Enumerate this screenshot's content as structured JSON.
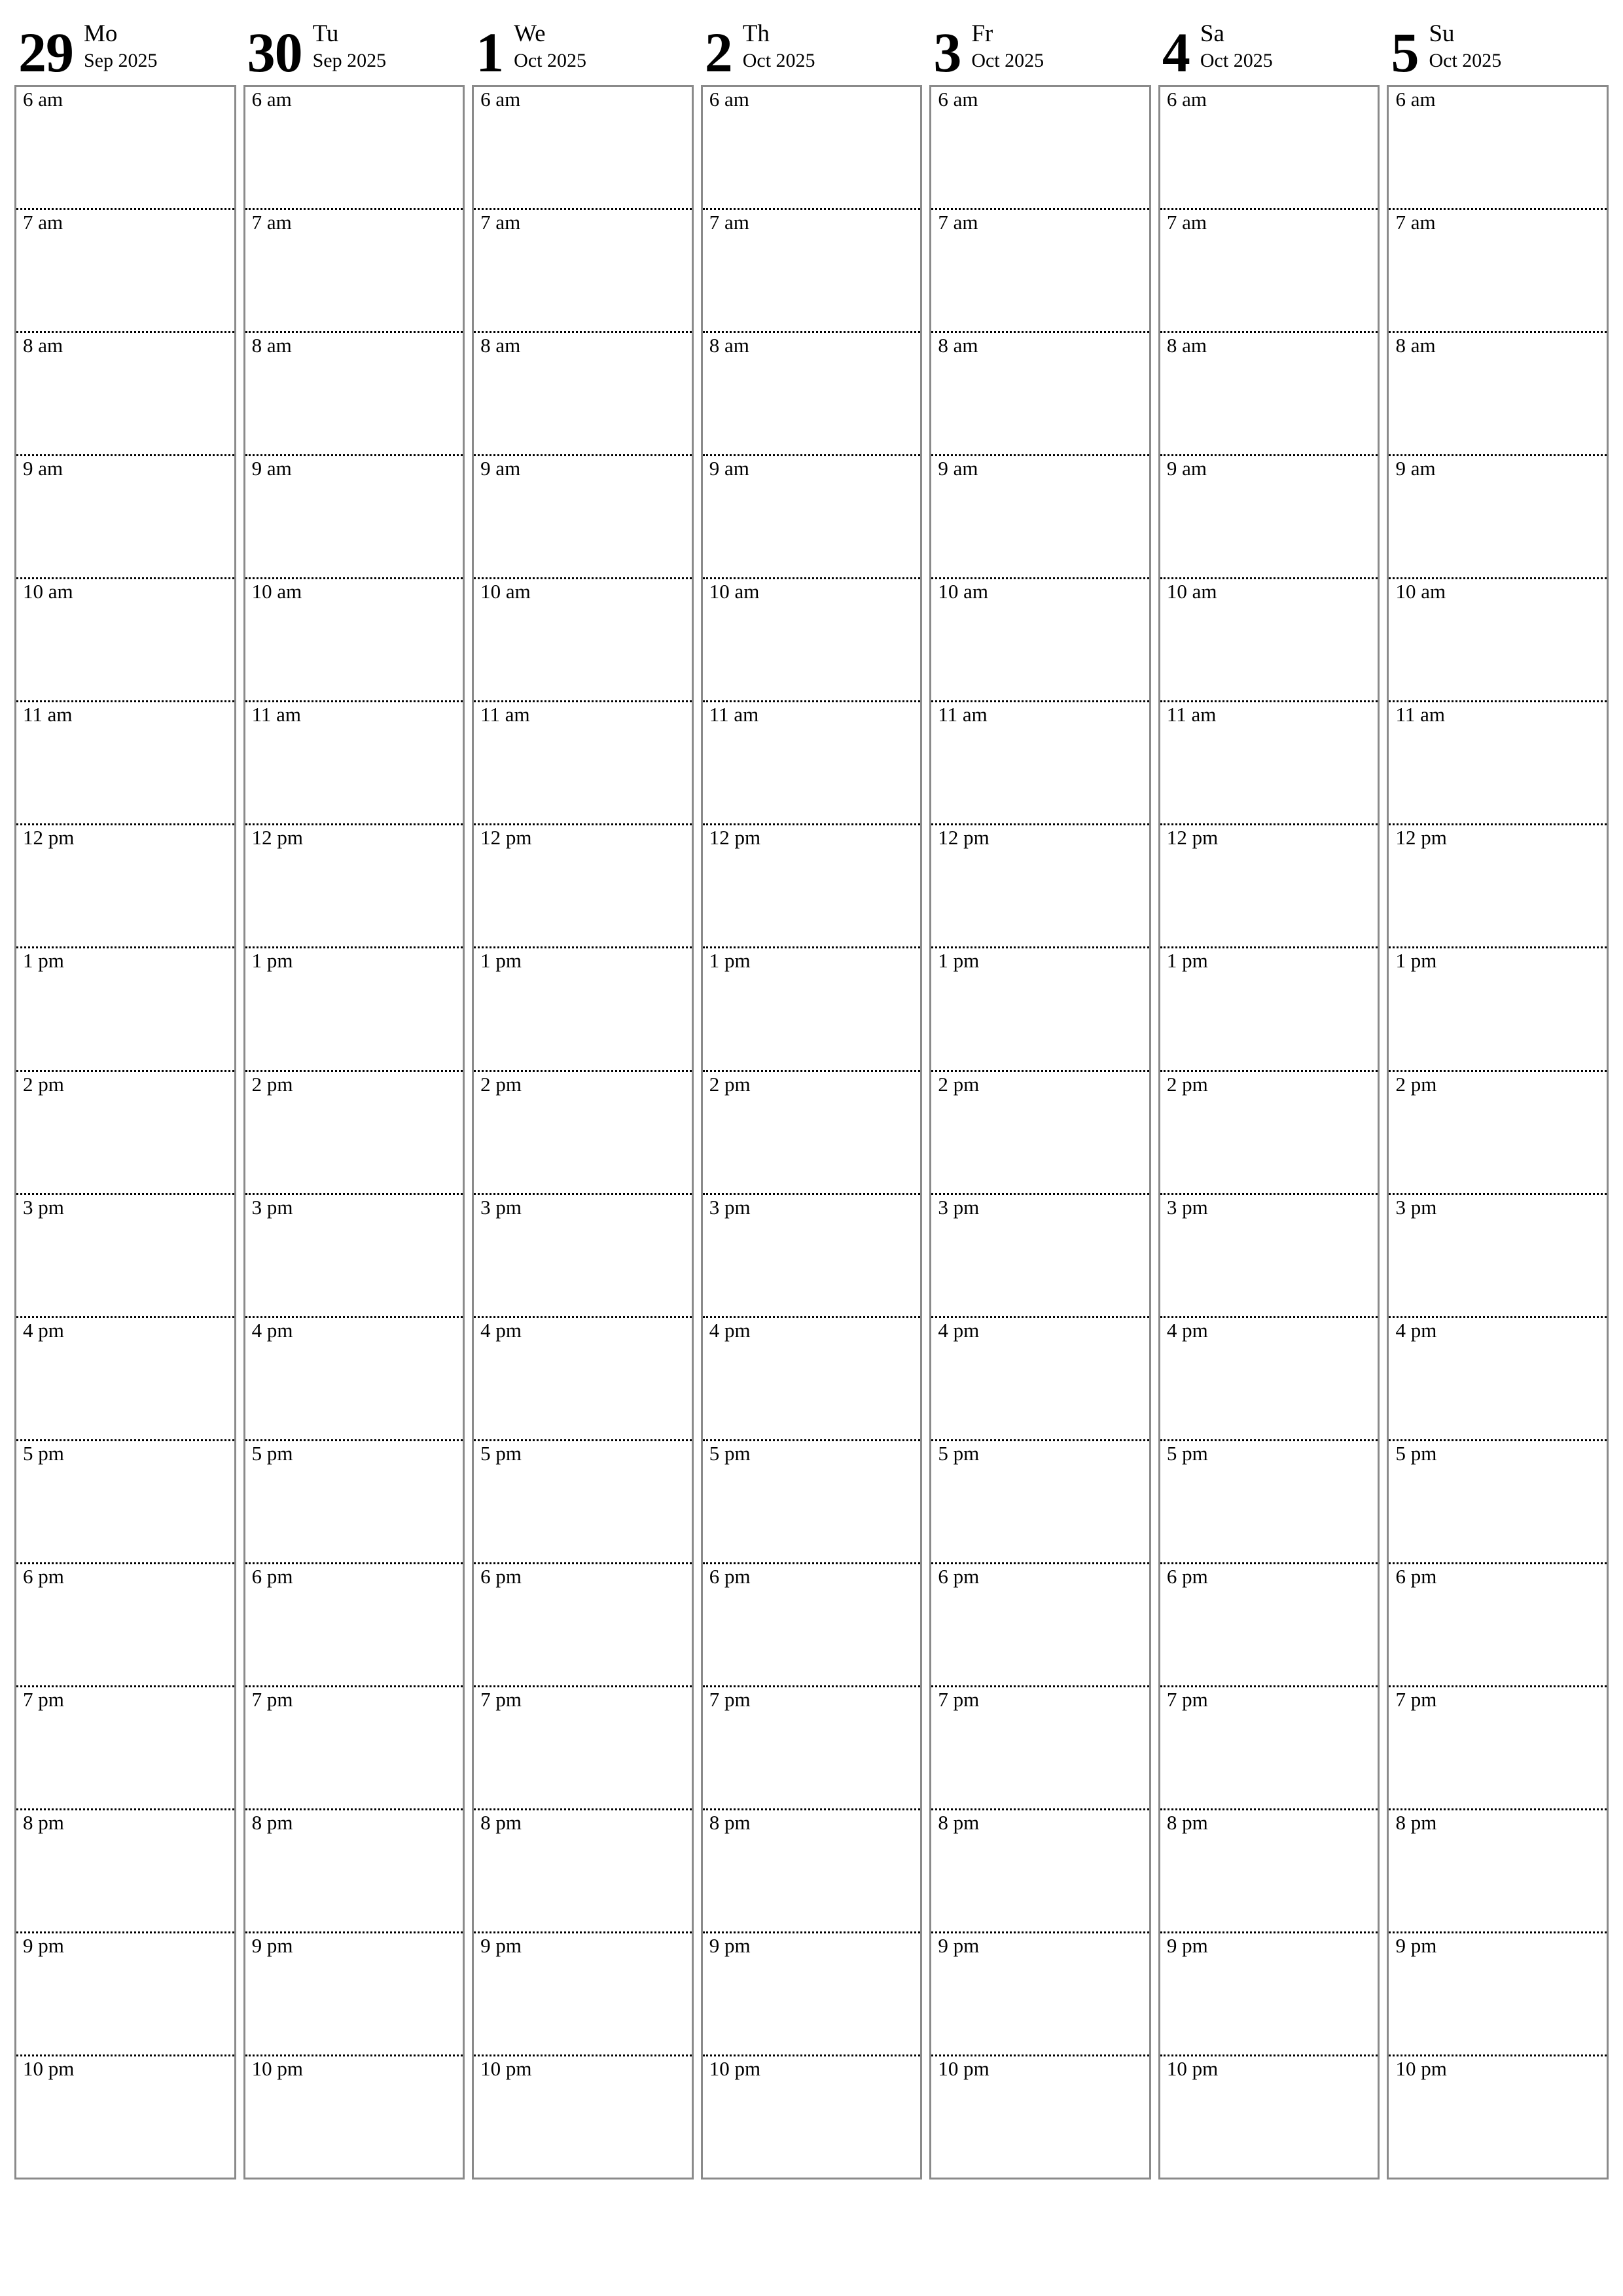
{
  "document": {
    "kind": "weekly-hourly-planner",
    "orientation": "portrait",
    "page_background": "#ffffff",
    "grid_border_color": "#8a8a8a",
    "divider_color": "#000000",
    "text_color": "#000000"
  },
  "hours": [
    "6 am",
    "7 am",
    "8 am",
    "9 am",
    "10 am",
    "11 am",
    "12 pm",
    "1 pm",
    "2 pm",
    "3 pm",
    "4 pm",
    "5 pm",
    "6 pm",
    "7 pm",
    "8 pm",
    "9 pm",
    "10 pm"
  ],
  "days": [
    {
      "number": "29",
      "weekday": "Mo",
      "month_year": "Sep 2025"
    },
    {
      "number": "30",
      "weekday": "Tu",
      "month_year": "Sep 2025"
    },
    {
      "number": "1",
      "weekday": "We",
      "month_year": "Oct 2025"
    },
    {
      "number": "2",
      "weekday": "Th",
      "month_year": "Oct 2025"
    },
    {
      "number": "3",
      "weekday": "Fr",
      "month_year": "Oct 2025"
    },
    {
      "number": "4",
      "weekday": "Sa",
      "month_year": "Oct 2025"
    },
    {
      "number": "5",
      "weekday": "Su",
      "month_year": "Oct 2025"
    }
  ]
}
